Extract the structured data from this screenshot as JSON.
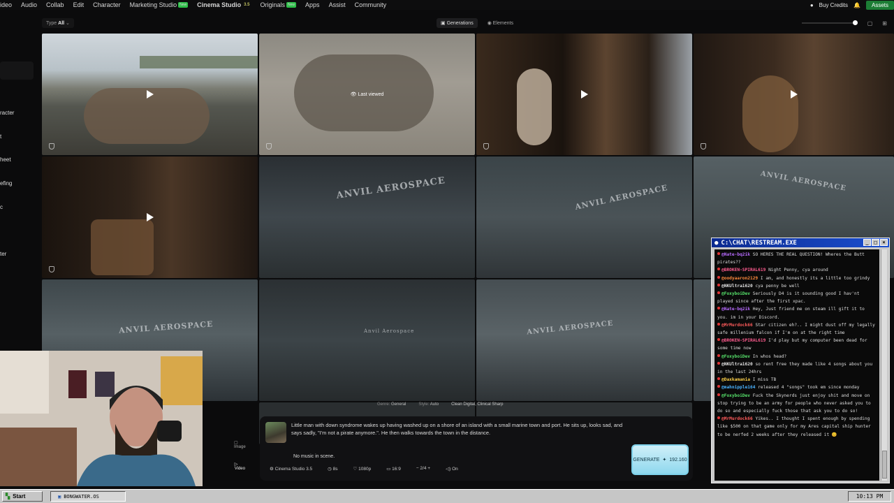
{
  "nav": {
    "items": [
      {
        "label": "ideo",
        "badge": ""
      },
      {
        "label": "Audio",
        "badge": ""
      },
      {
        "label": "Collab",
        "badge": ""
      },
      {
        "label": "Edit",
        "badge": ""
      },
      {
        "label": "Character",
        "badge": ""
      },
      {
        "label": "Marketing Studio",
        "badge": "New"
      },
      {
        "label": "Cinema Studio",
        "badge": "3.5"
      },
      {
        "label": "Originals",
        "badge": "New"
      },
      {
        "label": "Apps",
        "badge": ""
      },
      {
        "label": "Assist",
        "badge": ""
      },
      {
        "label": "Community",
        "badge": ""
      }
    ],
    "buy_credits": "Buy Credits",
    "assets": "Assets"
  },
  "filter": {
    "type_label": "Type",
    "type_value": "All",
    "tabs": [
      "Generations",
      "Elements"
    ]
  },
  "sidebar": {
    "items": [
      "racter",
      "t",
      "heet",
      "efing",
      "c",
      "ter"
    ]
  },
  "grid": {
    "last_viewed": "Last viewed",
    "overlay_texts": [
      "ANVIL AEROSPACE",
      "ANVIL AEROSPACE",
      "ANVIL AEROSPACE",
      "ANVIL AEROSPACE",
      "Anvil Aerospace",
      "ANVIL AEROSPACE"
    ]
  },
  "prompt": {
    "settings": [
      "General",
      "Auto",
      "Clean Digital, Clinical Sharp"
    ],
    "settings_labels": [
      "Genre:",
      "Style:"
    ],
    "text": "Little man with down syndrome wakes up having washed up on a shore of an island with a small marine town and port. He sits up, looks sad, and says sadly, \"I'm not a pirate anymore.\". He then walks towards the town in the distance.",
    "music": "No music in scene.",
    "options": {
      "model": "Cinema Studio 3.5",
      "duration": "8s",
      "resolution": "1080p",
      "aspect": "16:9",
      "count": "2/4",
      "audio": "On"
    },
    "generate_label": "GENERATE",
    "generate_cost": "192.160",
    "modes": [
      "Image",
      "Video"
    ]
  },
  "chat": {
    "title": "C:\\CHAT\\RESTREAM.EXE",
    "messages": [
      {
        "user": "@Nate-bq2ik",
        "color": "#b86bff",
        "text": "SO HERES THE REAL QUESTION! Wheres the Butt pirates??"
      },
      {
        "user": "@BROKEN-SPIRAL619",
        "color": "#ff5b8f",
        "text": "Night Penny, cya around"
      },
      {
        "user": "@oodyaaron2129",
        "color": "#ff8a3d",
        "text": "I am, and honestly its a little too grindy"
      },
      {
        "user": "@NKUltra1620",
        "color": "#e0e0e0",
        "text": "cya penny be well"
      },
      {
        "user": "@FoxyboiDev",
        "color": "#56e06a",
        "text": "Seriously D4 is it sounding good I hav'nt played since after the first xpac."
      },
      {
        "user": "@Nate-bq2ik",
        "color": "#b86bff",
        "text": "Hey, Just friend me on steam ill gift it to you. im in your Discord."
      },
      {
        "user": "@MrMurdock66",
        "color": "#ff5b5b",
        "text": "Star citizen eh?.. I might dust off my legally safe millenium falcon if I'm on at the right time"
      },
      {
        "user": "@BROKEN-SPIRAL619",
        "color": "#ff5b8f",
        "text": "I'd play but my computer been dead for some time now"
      },
      {
        "user": "@FoxyboiDev",
        "color": "#56e06a",
        "text": "In whos head?"
      },
      {
        "user": "@NKUltra1620",
        "color": "#e0e0e0",
        "text": "so rent free they made like 4 songs about you in the last 24hrs"
      },
      {
        "user": "@Daxkamania",
        "color": "#ffd24a",
        "text": "I miss TB"
      },
      {
        "user": "@mahnipple164",
        "color": "#4ab3ff",
        "text": "released 4 \"songs\" took em since monday"
      },
      {
        "user": "@FoxyboiDev",
        "color": "#56e06a",
        "text": "Fuck the Skynerds just enjoy shit and move on stop trying to be an army for people who never asked you to do so and especially fuck those that ask you to do so!"
      },
      {
        "user": "@MrMurdock66",
        "color": "#ff5b5b",
        "text": "Yikes.. I thought I spent enough by spending like $500 on that game only for my Ares capital ship hunter to be nerfed 2 weeks after they released it 😊"
      }
    ]
  },
  "taskbar": {
    "start": "Start",
    "task": "BONGWATER.OS",
    "clock": "10:13 PM"
  },
  "colors": {
    "accent_green": "#2fbf4a",
    "generate_cyan": "#8fd8ee",
    "chat_title_blue": "#0b2a90"
  }
}
